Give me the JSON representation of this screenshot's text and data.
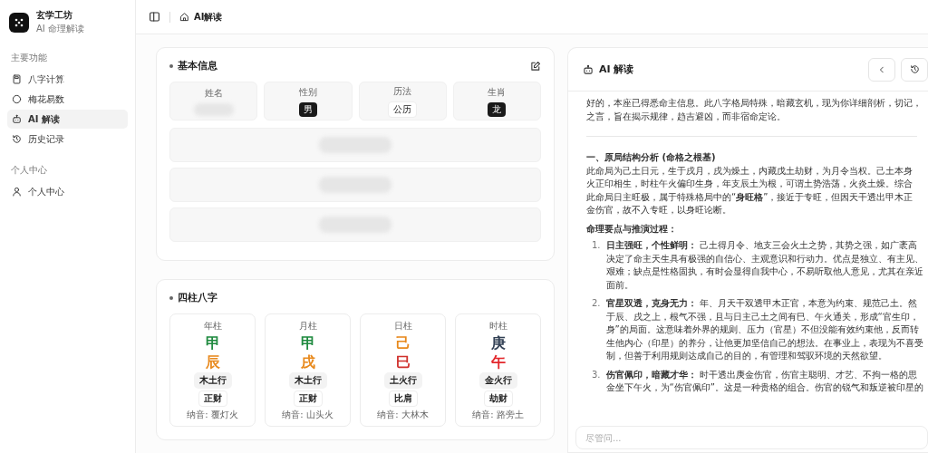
{
  "sidebar": {
    "brand": {
      "title": "玄学工坊",
      "subtitle": "AI 命理解读"
    },
    "sections": [
      {
        "title": "主要功能",
        "items": [
          {
            "label": "八字计算",
            "selected": false
          },
          {
            "label": "梅花易数",
            "selected": false
          },
          {
            "label": "AI 解读",
            "selected": true
          },
          {
            "label": "历史记录",
            "selected": false
          }
        ]
      },
      {
        "title": "个人中心",
        "items": [
          {
            "label": "个人中心",
            "selected": false
          }
        ]
      }
    ]
  },
  "topbar": {
    "breadcrumb": "AI解读"
  },
  "basic_info": {
    "title": "基本信息",
    "fields": [
      {
        "label": "姓名",
        "redacted": true
      },
      {
        "label": "性别",
        "value": "男"
      },
      {
        "label": "历法",
        "value": "公历"
      },
      {
        "label": "生肖",
        "value": "龙"
      }
    ],
    "rows": [
      {
        "redacted": true
      },
      {
        "redacted": true
      },
      {
        "redacted": true
      }
    ]
  },
  "four_pillars": {
    "title": "四柱八字",
    "pillars": [
      {
        "label": "年柱",
        "stem": {
          "char": "甲",
          "color": "#1f8a3f"
        },
        "branch": {
          "char": "辰",
          "color": "#e8891c"
        },
        "element": "木土行",
        "ten_god": "正财",
        "nayin": "纳音: 覆灯火"
      },
      {
        "label": "月柱",
        "stem": {
          "char": "甲",
          "color": "#1f8a3f"
        },
        "branch": {
          "char": "戌",
          "color": "#e8891c"
        },
        "element": "木土行",
        "ten_god": "正财",
        "nayin": "纳音: 山头火"
      },
      {
        "label": "日柱",
        "stem": {
          "char": "己",
          "color": "#e8891c"
        },
        "branch": {
          "char": "巳",
          "color": "#d0312d"
        },
        "element": "土火行",
        "ten_god": "比肩",
        "nayin": "纳音: 大林木"
      },
      {
        "label": "时柱",
        "stem": {
          "char": "庚",
          "color": "#334155"
        },
        "branch": {
          "char": "午",
          "color": "#e3262b"
        },
        "element": "金火行",
        "ten_god": "劫财",
        "nayin": "纳音: 路旁土"
      }
    ]
  },
  "ai_panel": {
    "title": "AI 解读",
    "intro": [
      "好的，本座已得悉命主信息。此八字格局特殊，暗藏玄机，现为你详细剖析，切记，",
      "之言，旨在揭示规律，趋吉避凶，而非宿命定论。"
    ],
    "heading": "一、原局结构分析 (命格之根基)",
    "analysis": [
      "此命局为己土日元，生于戌月，戌为燥土，内藏戊土劫财，为月令当权。己土本身",
      "火正印相生，时柱午火偏印生身，年支辰土为根，可谓土势浩荡，火炎土燥。综合",
      "此命局日主旺极，属于特殊格局中的“**身旺格**”，接近于专旺，但因天干透出甲木正",
      "金伤官，故不入专旺，以身旺论断。"
    ],
    "subheading": "命理要点与推演过程：",
    "points": [
      {
        "number": "1.",
        "lines": [
          "**日主强旺，个性鲜明：** 己土得月令、地支三会火土之势，其势之强，如广袤高",
          "决定了命主天生具有极强的自信心、主观意识和行动力。优点是独立、有主见、",
          "艰难；缺点是性格固执，有时会显得自我中心，不易听取他人意见，尤其在亲近",
          "面前。"
        ]
      },
      {
        "number": "2.",
        "lines": [
          "**官星双透，克身无力：** 年、月天干双透甲木正官，本意为约束、规范己土。然",
          "于辰、戌之上，根气不强，且与日主己土之间有巳、午火通关，形成“官生印，",
          "身”的局面。这意味着外界的规则、压力（官星）不但没能有效约束他，反而转",
          "生他内心（印星）的养分，让他更加坚信自己的想法。在事业上，表现为不喜受",
          "制，但善于利用规则达成自己的目的，有管理和驾驭环境的天然欲望。"
        ]
      },
      {
        "number": "3.",
        "lines": [
          "**伤官佩印，暗藏才华：** 时干透出庚金伤官，伤官主聪明、才艺、不拘一格的思",
          "金坐下午火，为“伤官佩印”。这是一种贵格的组合。伤官的锐气和叛逆被印星的"
        ]
      }
    ],
    "input": {
      "placeholder": "尽管问..."
    }
  }
}
